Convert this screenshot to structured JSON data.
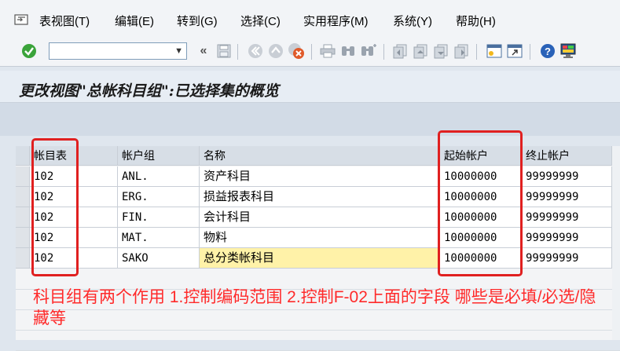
{
  "menu": {
    "items": [
      {
        "label": "表视图(T)"
      },
      {
        "label": "编辑(E)"
      },
      {
        "label": "转到(G)"
      },
      {
        "label": "选择(C)"
      },
      {
        "label": "实用程序(M)"
      },
      {
        "label": "系统(Y)"
      },
      {
        "label": "帮助(H)"
      }
    ]
  },
  "toolbar": {
    "command_field_value": "",
    "icons": [
      "enter-icon",
      "save-icon",
      "back-icon",
      "exit-icon",
      "cancel-icon",
      "print-icon",
      "find-icon",
      "find-next-icon",
      "first-page-icon",
      "previous-page-icon",
      "next-page-icon",
      "last-page-icon",
      "create-session-icon",
      "shortcut-icon",
      "help-icon",
      "customize-layout-icon"
    ],
    "colors": {
      "enter": "#3aa33a",
      "cancel": "#e05a2a",
      "help": "#2a62b8"
    }
  },
  "page": {
    "title": "更改视图\"总帐科目组\":已选择集的概览"
  },
  "table": {
    "headers": [
      "帐目表",
      "帐户组",
      "名称",
      "起始帐户",
      "终止帐户"
    ],
    "rows": [
      [
        "102",
        "ANL.",
        "资产科目",
        "10000000",
        "99999999"
      ],
      [
        "102",
        "ERG.",
        "损益报表科目",
        "10000000",
        "99999999"
      ],
      [
        "102",
        "FIN.",
        "会计科目",
        "10000000",
        "99999999"
      ],
      [
        "102",
        "MAT.",
        "物料",
        "10000000",
        "99999999"
      ],
      [
        "102",
        "SAKO",
        "总分类帐科目",
        "10000000",
        "99999999"
      ]
    ]
  },
  "annotation": {
    "text": "科目组有两个作用 1.控制编码范围 2.控制F-02上面的字段 哪些是必填/必选/隐藏等",
    "color": "#ff2a2a"
  }
}
